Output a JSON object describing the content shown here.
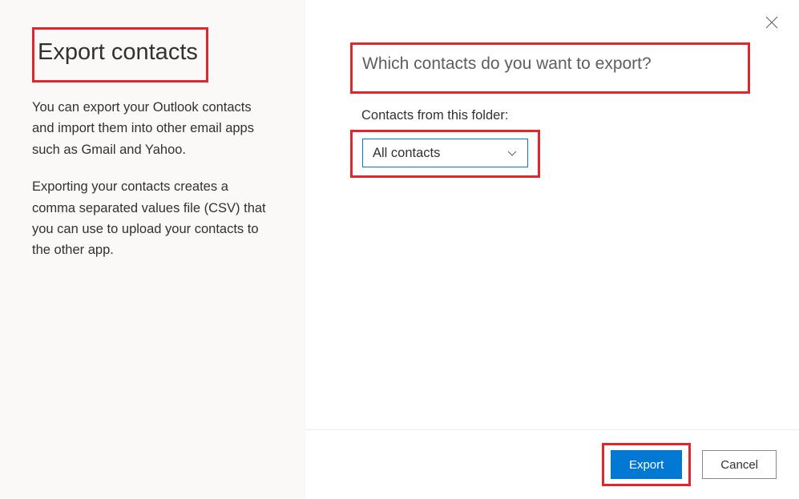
{
  "sidebar": {
    "title": "Export contacts",
    "description1": "You can export your Outlook contacts and import them into other email apps such as Gmail and Yahoo.",
    "description2": "Exporting your contacts creates a comma separated values file (CSV) that you can use to upload your contacts to the other app."
  },
  "main": {
    "heading": "Which contacts do you want to export?",
    "folder_label": "Contacts from this folder:",
    "dropdown_selected": "All contacts"
  },
  "footer": {
    "export_label": "Export",
    "cancel_label": "Cancel"
  }
}
